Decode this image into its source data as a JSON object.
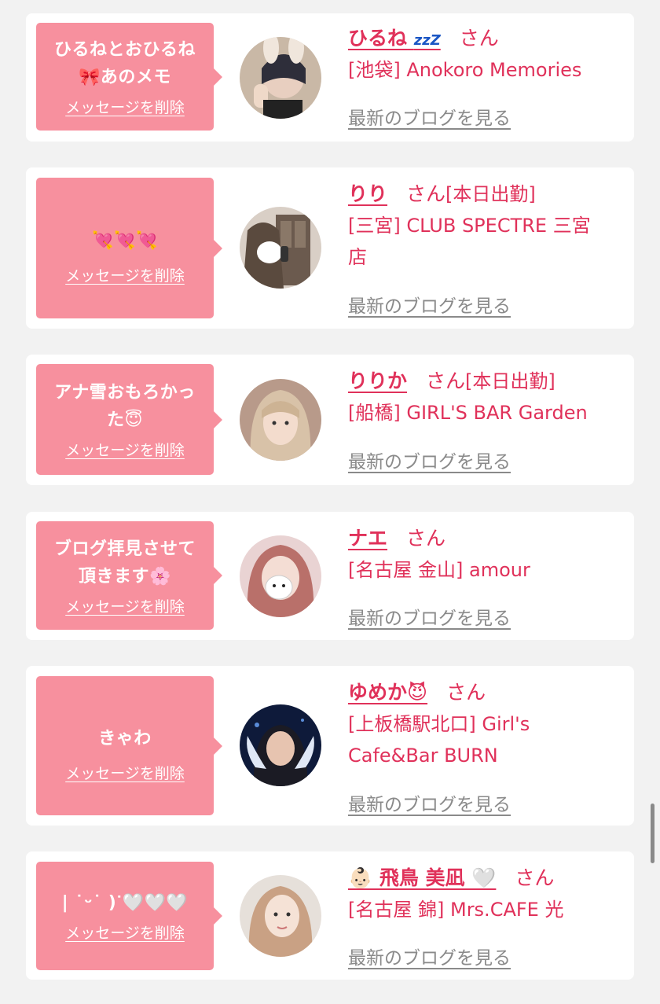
{
  "messages": [
    {
      "bubble_text": "ひるねとおひるね🎀あのメモ",
      "bubble_line1": "ひるねとおひるね",
      "bubble_line2": "🎀あのメモ",
      "delete_label": "メッセージを削除",
      "name": "ひるね",
      "name_emoji": "zzZ",
      "honorific": "さん",
      "status": "",
      "shop": "[池袋] Anokoro Memories",
      "blog_link": "最新のブログを見る",
      "avatar": "avatar-photo"
    },
    {
      "bubble_text": "💘💘💘",
      "delete_label": "メッセージを削除",
      "name": "りり",
      "honorific": "さん",
      "status": "[本日出勤]",
      "shop_line1": "[三宮] CLUB SPECTRE 三宮",
      "shop_line2": "店",
      "blog_link": "最新のブログを見る",
      "avatar": "avatar-photo"
    },
    {
      "bubble_text": "アナ雪おもろかった😇",
      "bubble_line1": "アナ雪おもろかっ",
      "bubble_line2": "た😇",
      "delete_label": "メッセージを削除",
      "name": "りりか",
      "honorific": "さん",
      "status": "[本日出勤]",
      "shop": "[船橋] GIRL'S BAR Garden",
      "blog_link": "最新のブログを見る",
      "avatar": "avatar-photo"
    },
    {
      "bubble_text": "ブログ拝見させて頂きます🌸",
      "bubble_line1": "ブログ拝見させて",
      "bubble_line2": "頂きます🌸",
      "delete_label": "メッセージを削除",
      "name": "ナエ",
      "honorific": "さん",
      "status": "",
      "shop": "[名古屋 金山] amour",
      "blog_link": "最新のブログを見る",
      "avatar": "avatar-photo"
    },
    {
      "bubble_text": "きゃわ",
      "delete_label": "メッセージを削除",
      "name": "ゆめか😈",
      "honorific": "さん",
      "status": "",
      "shop_line1": "[上板橋駅北口] Girl's",
      "shop_line2": "Cafe&Bar BURN",
      "blog_link": "最新のブログを見る",
      "avatar": "avatar-photo"
    },
    {
      "bubble_text": "| ˙ᵕ˙ )ᐝ🤍🤍🤍",
      "delete_label": "メッセージを削除",
      "name": "👶🏻 飛鳥 美凪 🤍",
      "honorific": "さん",
      "status": "",
      "shop": "[名古屋 錦] Mrs.CAFE 光",
      "blog_link": "最新のブログを見る",
      "avatar": "avatar-photo"
    }
  ],
  "colors": {
    "bubble": "#f7909e",
    "accent": "#e0315a",
    "link_gray": "#8a8a8a",
    "background": "#f2f2f2"
  }
}
